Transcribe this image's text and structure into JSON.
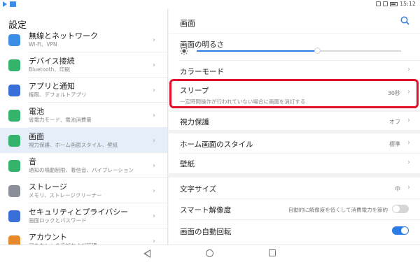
{
  "status_bar": {
    "time": "15:12"
  },
  "left_panel": {
    "title": "設定",
    "items": [
      {
        "title": "無線とネットワーク",
        "subtitle": "Wi-Fi、VPN",
        "icon": "wifi-icon",
        "color": "#3a8ee6"
      },
      {
        "title": "デバイス接続",
        "subtitle": "Bluetooth、印刷",
        "icon": "device-connect-icon",
        "color": "#33b36b"
      },
      {
        "title": "アプリと通知",
        "subtitle": "権限、デフォルトアプリ",
        "icon": "apps-icon",
        "color": "#3a6fd8"
      },
      {
        "title": "電池",
        "subtitle": "省電力モード、電池消費量",
        "icon": "battery-icon",
        "color": "#33b36b"
      },
      {
        "title": "画面",
        "subtitle": "視力保護、ホーム画面スタイル、壁紙",
        "icon": "display-icon",
        "color": "#33b36b"
      },
      {
        "title": "音",
        "subtitle": "通知の鳴動制限、着信音、バイブレーション",
        "icon": "sound-icon",
        "color": "#33b36b"
      },
      {
        "title": "ストレージ",
        "subtitle": "メモリ、ストレージクリーナー",
        "icon": "storage-icon",
        "color": "#8a8f99"
      },
      {
        "title": "セキュリティとプライバシー",
        "subtitle": "画面ロックとパスワード",
        "icon": "shield-icon",
        "color": "#3a6fd8"
      },
      {
        "title": "アカウント",
        "subtitle": "アカウントの追加および管理",
        "icon": "account-icon",
        "color": "#e8892b"
      }
    ]
  },
  "right_panel": {
    "title": "画面",
    "brightness": {
      "label": "画面の明るさ",
      "level": 0.59
    },
    "color_mode": {
      "label": "カラーモード"
    },
    "sleep": {
      "label": "スリープ",
      "subtitle": "一定時間操作が行われていない場合に画面を消灯する",
      "value": "30秒"
    },
    "eye_comfort": {
      "label": "視力保護",
      "value": "オフ"
    },
    "home_style": {
      "label": "ホーム画面のスタイル",
      "value": "標準"
    },
    "wallpaper": {
      "label": "壁紙"
    },
    "text_size": {
      "label": "文字サイズ",
      "value": "中"
    },
    "smart_resolution": {
      "label": "スマート解像度",
      "value": "自動的に解像度を低くして消費電力を節約",
      "on": false
    },
    "auto_rotate": {
      "label": "画面の自動回転",
      "on": true
    }
  },
  "colors": {
    "accent": "#2a7be4",
    "highlight": "#e0102a"
  }
}
